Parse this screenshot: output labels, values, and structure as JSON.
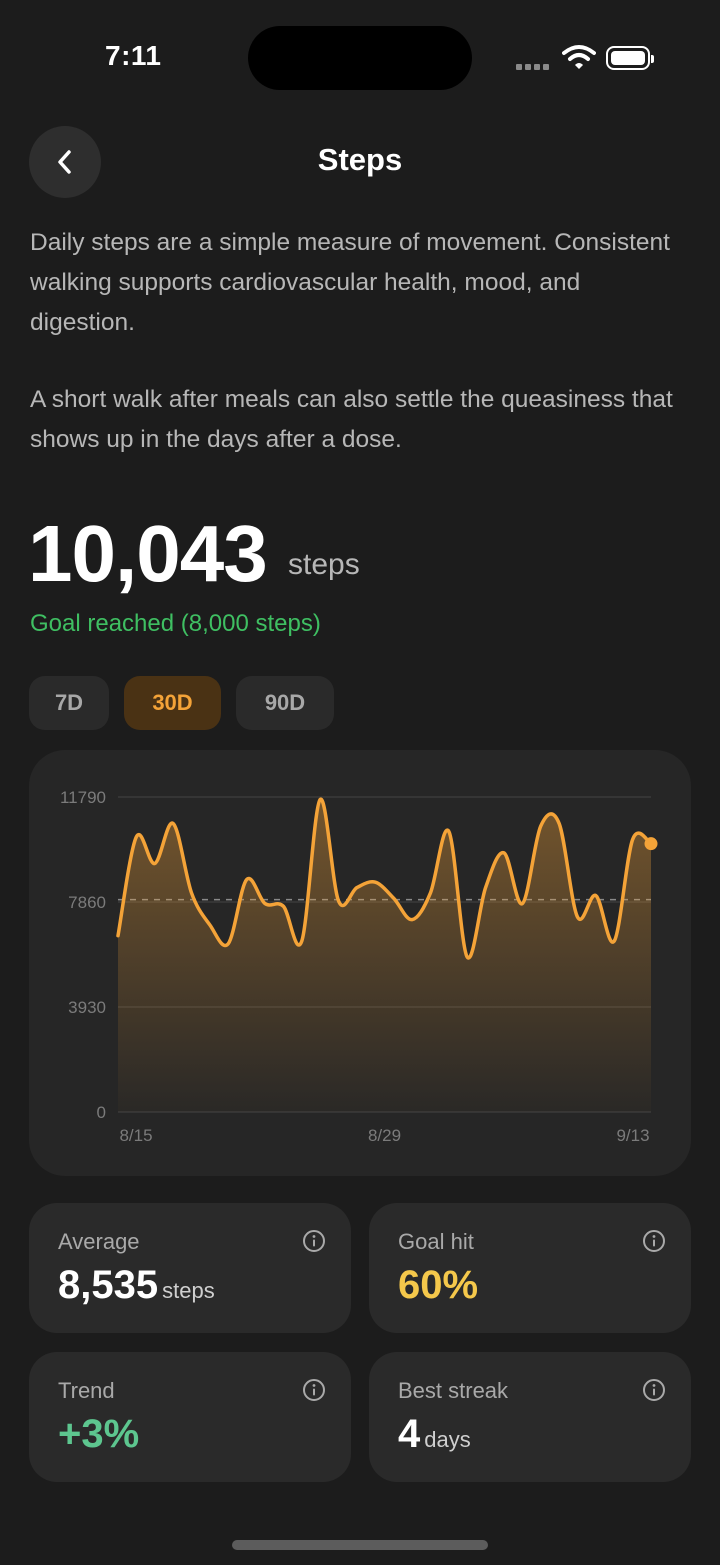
{
  "status_bar": {
    "time": "7:11"
  },
  "header": {
    "title": "Steps",
    "back_icon": "chevron-left-icon"
  },
  "description": {
    "p1": "Daily steps are a simple measure of movement. Consistent walking supports cardiovascular health, mood, and digestion.",
    "p2": "A short walk after meals can also settle the queasiness that shows up in the days after a dose."
  },
  "today": {
    "value": "10,043",
    "unit": "steps",
    "goal_text": "Goal reached (8,000 steps)"
  },
  "range_tabs": [
    {
      "label": "7D",
      "active": false
    },
    {
      "label": "30D",
      "active": true
    },
    {
      "label": "90D",
      "active": false
    }
  ],
  "chart_data": {
    "type": "area",
    "ylim": [
      0,
      11790
    ],
    "y_ticks": [
      "11790",
      "7860",
      "3930",
      "0"
    ],
    "x_tick_labels": [
      "8/15",
      "8/29",
      "9/13"
    ],
    "goal_line": 7950,
    "line_color": "#f4a338",
    "values": [
      6600,
      10300,
      9300,
      10800,
      8200,
      7000,
      6300,
      8700,
      7800,
      7700,
      6400,
      11700,
      7900,
      8400,
      8600,
      8000,
      7200,
      8200,
      10500,
      5800,
      8400,
      9700,
      7800,
      10700,
      10800,
      7300,
      8100,
      6400,
      10200,
      10043
    ]
  },
  "stats": [
    {
      "label": "Average",
      "value": "8,535",
      "unit": "steps",
      "color": "#ffffff",
      "icon": "info-icon"
    },
    {
      "label": "Goal hit",
      "value": "60%",
      "unit": "",
      "color": "#f5c84b",
      "icon": "info-icon"
    },
    {
      "label": "Trend",
      "value": "+3%",
      "unit": "",
      "color": "#5dc68f",
      "icon": "info-icon"
    },
    {
      "label": "Best streak",
      "value": "4",
      "unit": "days",
      "color": "#ffffff",
      "icon": "info-icon"
    }
  ]
}
